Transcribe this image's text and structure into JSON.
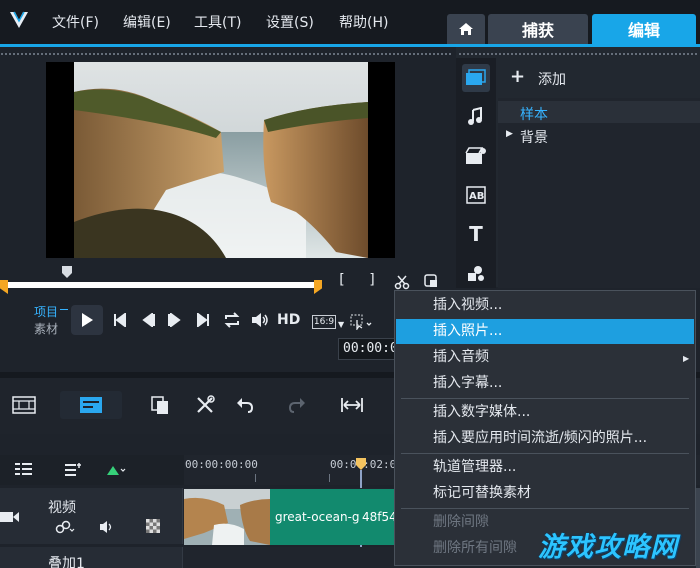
{
  "menubar": {
    "file": "文件(F)",
    "edit": "编辑(E)",
    "tools": "工具(T)",
    "settings": "设置(S)",
    "help": "帮助(H)"
  },
  "tabs": {
    "capture": "捕获",
    "edit": "编辑"
  },
  "player": {
    "mode_project": "项目",
    "mode_clip": "素材",
    "hd": "HD",
    "aspect": "16:9",
    "timecode": "00:00:0"
  },
  "library": {
    "add": "添加",
    "items": [
      "样本",
      "背景"
    ]
  },
  "context_menu": {
    "items": [
      "插入视频...",
      "插入照片...",
      "插入音频",
      "插入字幕...",
      "插入数字媒体...",
      "插入要应用时间流逝/频闪的照片...",
      "轨道管理器...",
      "标记可替换素材",
      "删除间隙",
      "删除所有间隙"
    ]
  },
  "timeline": {
    "ruler_start": "00:00:00:00",
    "ruler_next": "00:00:02:00",
    "track_video": "视频",
    "track_overlay": "叠加1",
    "clip_label": "great-ocean-g",
    "clip_label2": "48f54"
  },
  "watermark": "游戏攻略网"
}
